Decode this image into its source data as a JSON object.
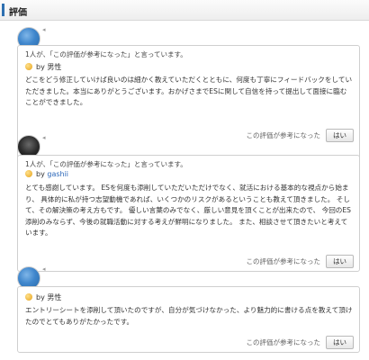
{
  "section": {
    "title": "評価"
  },
  "reviews": [
    {
      "helpful_text": "1人が、「この評価が参考になった」と言っています。",
      "author_prefix": "by",
      "author": "男性",
      "body": "どこをどう修正していけば良いのは細かく教えていただくとともに、何度も丁寧にフィードバックをしていただきました。本当にありがとうございます。おかげさまでESに関して自信を持って提出して面接に臨むことができました。",
      "feedback_prompt": "この評価が参考になった",
      "yes_label": "はい"
    },
    {
      "helpful_text": "1人が、「この評価が参考になった」と言っています。",
      "author_prefix": "by",
      "author": "gashii",
      "body": "とても感謝しています。 ESを何度も添削していただいただけでなく、就活における基本的な視点から始まり、 具体的に私が持つ志望動機であれば、いくつかのリスクがあるということも教えて頂きました。 そして、その解決策の考え方もです。 優しい言葉のみでなく、厳しい意見を頂くことが出来たので、 今回のES添削のみならず、今後の就職活動に対する考えが鮮明になりました。 また、相談させて頂きたいと考えています。",
      "feedback_prompt": "この評価が参考になった",
      "yes_label": "はい"
    },
    {
      "helpful_text": "",
      "author_prefix": "by",
      "author": "男性",
      "body": "エントリーシートを添削して頂いたのですが、自分が気づけなかった、より魅力的に書ける点を教えて頂けたのでとてもありがたかったです。",
      "feedback_prompt": "この評価が参考になった",
      "yes_label": "はい"
    }
  ]
}
